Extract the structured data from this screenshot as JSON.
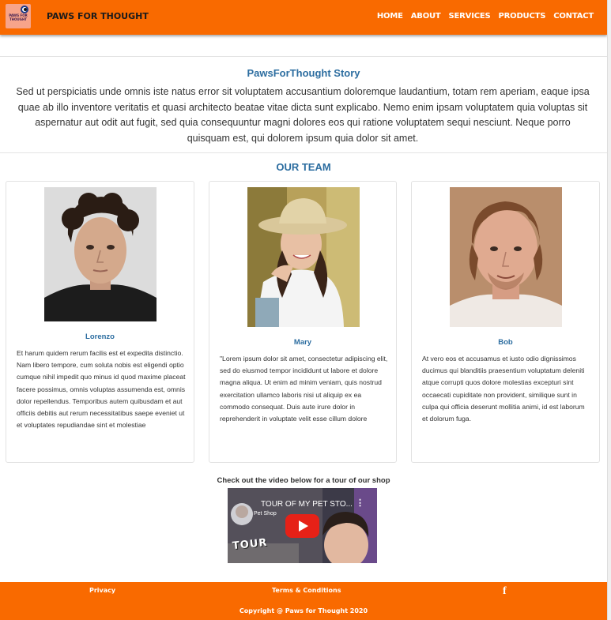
{
  "header": {
    "logo_text": "PAWS FOR THOUGHT",
    "brand": "PAWS FOR THOUGHT",
    "nav": [
      "HOME",
      "ABOUT",
      "SERVICES",
      "PRODUCTS",
      "CONTACT"
    ]
  },
  "story": {
    "title": "PawsForThought Story",
    "text": "Sed ut perspiciatis unde omnis iste natus error sit voluptatem accusantium doloremque laudantium, totam rem aperiam, eaque ipsa quae ab illo inventore veritatis et quasi architecto beatae vitae dicta sunt explicabo. Nemo enim ipsam voluptatem quia voluptas sit aspernatur aut odit aut fugit, sed quia consequuntur magni dolores eos qui ratione voluptatem sequi nesciunt. Neque porro quisquam est, qui dolorem ipsum quia dolor sit amet."
  },
  "team": {
    "title": "OUR TEAM",
    "members": [
      {
        "name": "Lorenzo",
        "bio": "Et harum quidem rerum facilis est et expedita distinctio. Nam libero tempore, cum soluta nobis est eligendi optio cumque nihil impedit quo minus id quod maxime placeat facere possimus, omnis voluptas assumenda est, omnis dolor repellendus. Temporibus autem quibusdam et aut officiis debitis aut rerum necessitatibus saepe eveniet ut et voluptates repudiandae sint et molestiae"
      },
      {
        "name": "Mary",
        "bio": "\"Lorem ipsum dolor sit amet, consectetur adipiscing elit, sed do eiusmod tempor incididunt ut labore et dolore magna aliqua. Ut enim ad minim veniam, quis nostrud exercitation ullamco laboris nisi ut aliquip ex ea commodo consequat. Duis aute irure dolor in reprehenderit in voluptate velit esse cillum dolore"
      },
      {
        "name": "Bob",
        "bio": "At vero eos et accusamus et iusto odio dignissimos ducimus qui blanditiis praesentium voluptatum deleniti atque corrupti quos dolore molestias excepturi sint occaecati cupiditate non provident, similique sunt in culpa qui officia deserunt mollitia animi, id est laborum et dolorum fuga."
      }
    ]
  },
  "video": {
    "caption": "Check out the video below for a tour of our shop",
    "title": "TOUR OF MY PET STO...",
    "overlay_text": "TOUR",
    "badge_text": "Pet Shop"
  },
  "footer": {
    "privacy": "Privacy",
    "terms": "Terms & Conditions",
    "copyright": "Copyright @ Paws for Thought 2020",
    "social_icon": "facebook-icon"
  },
  "colors": {
    "accent": "#f96a00",
    "heading": "#2c6da0"
  }
}
